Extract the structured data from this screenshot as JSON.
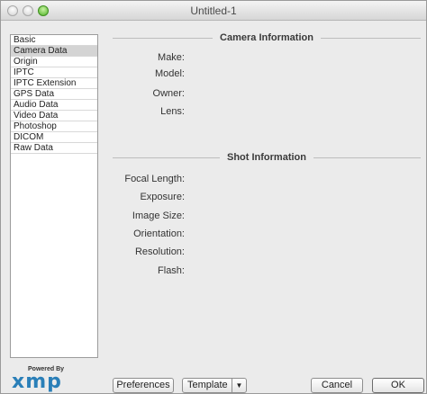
{
  "window": {
    "title": "Untitled-1"
  },
  "sidebar": {
    "items": [
      {
        "label": "Basic",
        "selected": false
      },
      {
        "label": "Camera Data",
        "selected": true
      },
      {
        "label": "Origin",
        "selected": false
      },
      {
        "label": "IPTC",
        "selected": false
      },
      {
        "label": "IPTC Extension",
        "selected": false
      },
      {
        "label": "GPS Data",
        "selected": false
      },
      {
        "label": "Audio Data",
        "selected": false
      },
      {
        "label": "Video Data",
        "selected": false
      },
      {
        "label": "Photoshop",
        "selected": false
      },
      {
        "label": "DICOM",
        "selected": false
      },
      {
        "label": "Raw Data",
        "selected": false
      }
    ]
  },
  "camera_info": {
    "header": "Camera Information",
    "fields": [
      "Make:",
      "Model:",
      "Owner:",
      "Lens:"
    ]
  },
  "shot_info": {
    "header": "Shot Information",
    "fields": [
      "Focal Length:",
      "Exposure:",
      "Image Size:",
      "Orientation:",
      "Resolution:",
      "Flash:"
    ]
  },
  "footer": {
    "powered_by": "Powered By",
    "logo_text": "xmp",
    "preferences_label": "Preferences",
    "template_label": "Template",
    "template_arrow": "▼",
    "cancel_label": "Cancel",
    "ok_label": "OK"
  },
  "colors": {
    "logo": "#2a7fb8",
    "selected_row": "#d4d4d4"
  }
}
